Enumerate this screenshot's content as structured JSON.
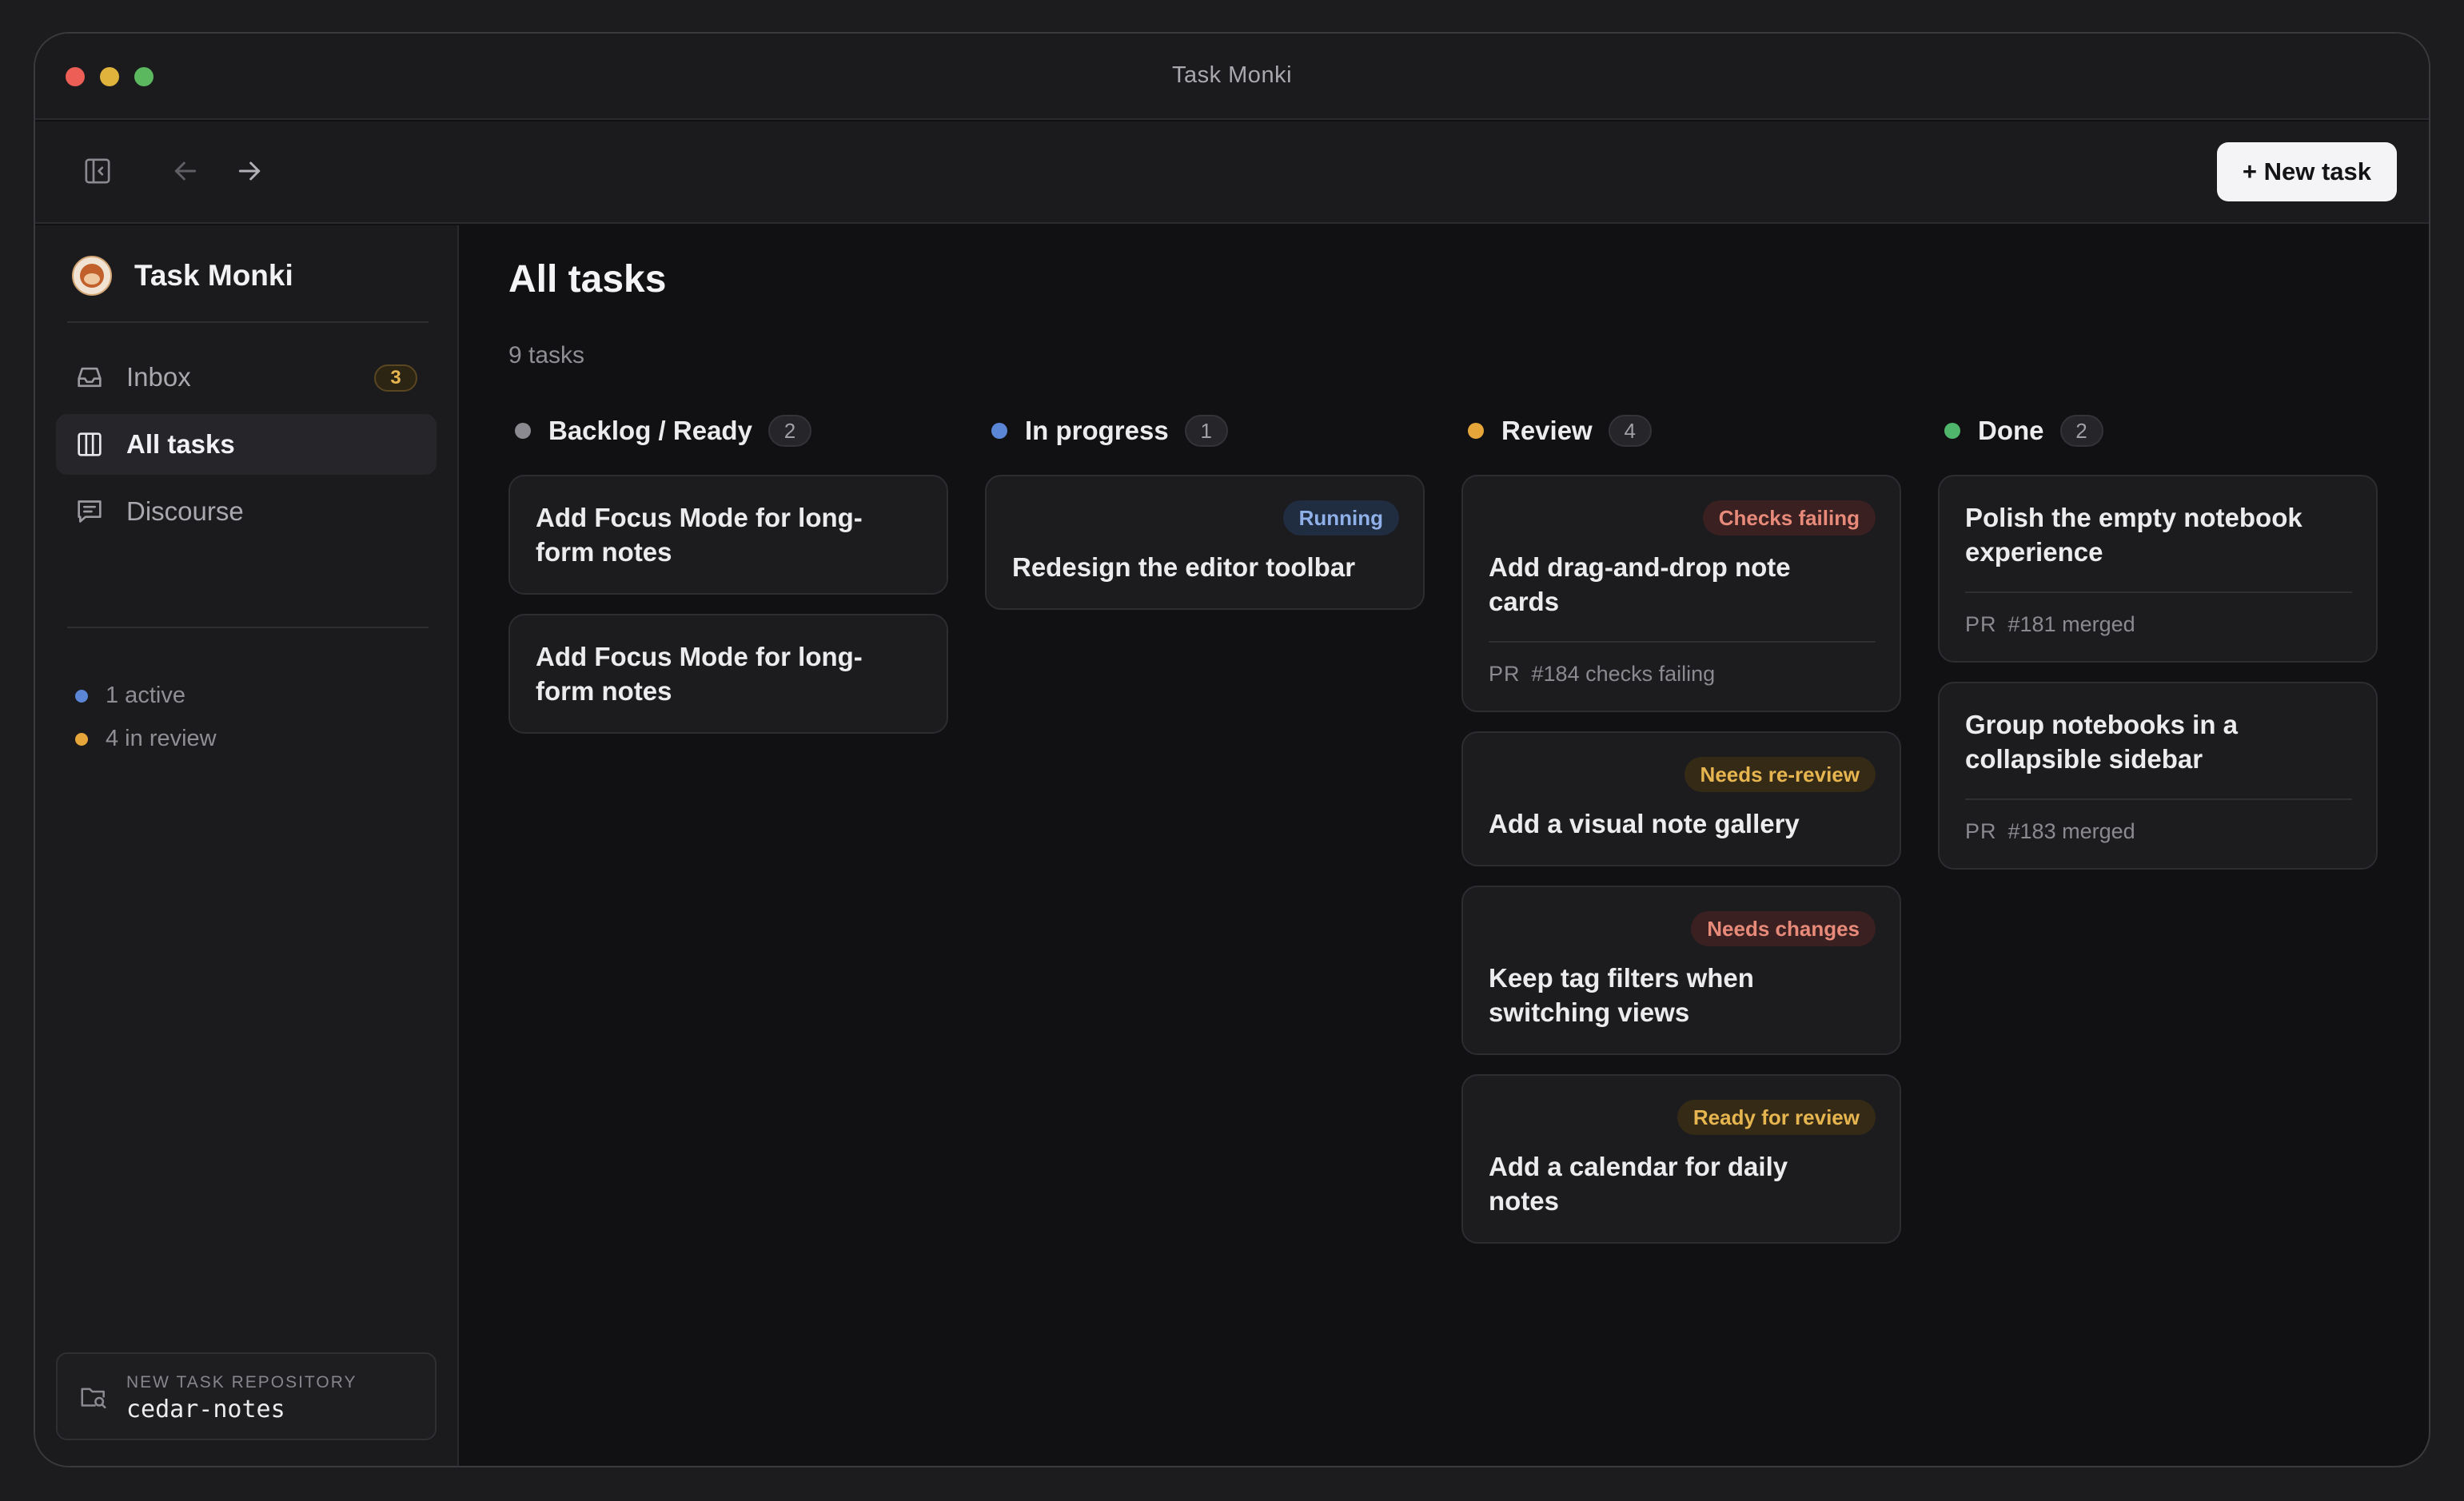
{
  "window": {
    "title": "Task Monki"
  },
  "toolbar": {
    "new_task_label": "+ New task"
  },
  "sidebar": {
    "brand_name": "Task Monki",
    "nav": [
      {
        "label": "Inbox",
        "icon": "inbox-icon",
        "badge": "3",
        "active": false
      },
      {
        "label": "All tasks",
        "icon": "columns-icon",
        "active": true
      },
      {
        "label": "Discourse",
        "icon": "message-icon",
        "active": false
      }
    ],
    "stats": [
      {
        "label": "1 active",
        "color": "#5b86d6"
      },
      {
        "label": "4 in review",
        "color": "#e6a63a"
      }
    ],
    "repo": {
      "label": "NEW TASK REPOSITORY",
      "name": "cedar-notes"
    }
  },
  "main": {
    "title": "All tasks",
    "subtitle": "9 tasks",
    "columns": [
      {
        "title": "Backlog / Ready",
        "count": "2",
        "color": "#8a8a90",
        "cards": [
          {
            "title": "Add Focus Mode for long-form notes"
          },
          {
            "title": "Add Focus Mode for long-form notes"
          }
        ]
      },
      {
        "title": "In progress",
        "count": "1",
        "color": "#5b86d6",
        "cards": [
          {
            "title": "Redesign the editor toolbar",
            "status": "Running",
            "status_kind": "running"
          }
        ]
      },
      {
        "title": "Review",
        "count": "4",
        "color": "#e6a63a",
        "cards": [
          {
            "title": "Add drag-and-drop note cards",
            "status": "Checks failing",
            "status_kind": "failing",
            "pr_label": "PR",
            "pr_text": "#184 checks failing"
          },
          {
            "title": "Add a visual note gallery",
            "status": "Needs re-review",
            "status_kind": "rereview"
          },
          {
            "title": "Keep tag filters when switching views",
            "status": "Needs changes",
            "status_kind": "changes"
          },
          {
            "title": "Add a calendar for daily notes",
            "status": "Ready for review",
            "status_kind": "ready"
          }
        ]
      },
      {
        "title": "Done",
        "count": "2",
        "color": "#4fb56a",
        "cards": [
          {
            "title": "Polish the empty notebook experience",
            "pr_label": "PR",
            "pr_text": "#181 merged"
          },
          {
            "title": "Group notebooks in a collapsible sidebar",
            "pr_label": "PR",
            "pr_text": "#183 merged"
          }
        ]
      }
    ]
  }
}
